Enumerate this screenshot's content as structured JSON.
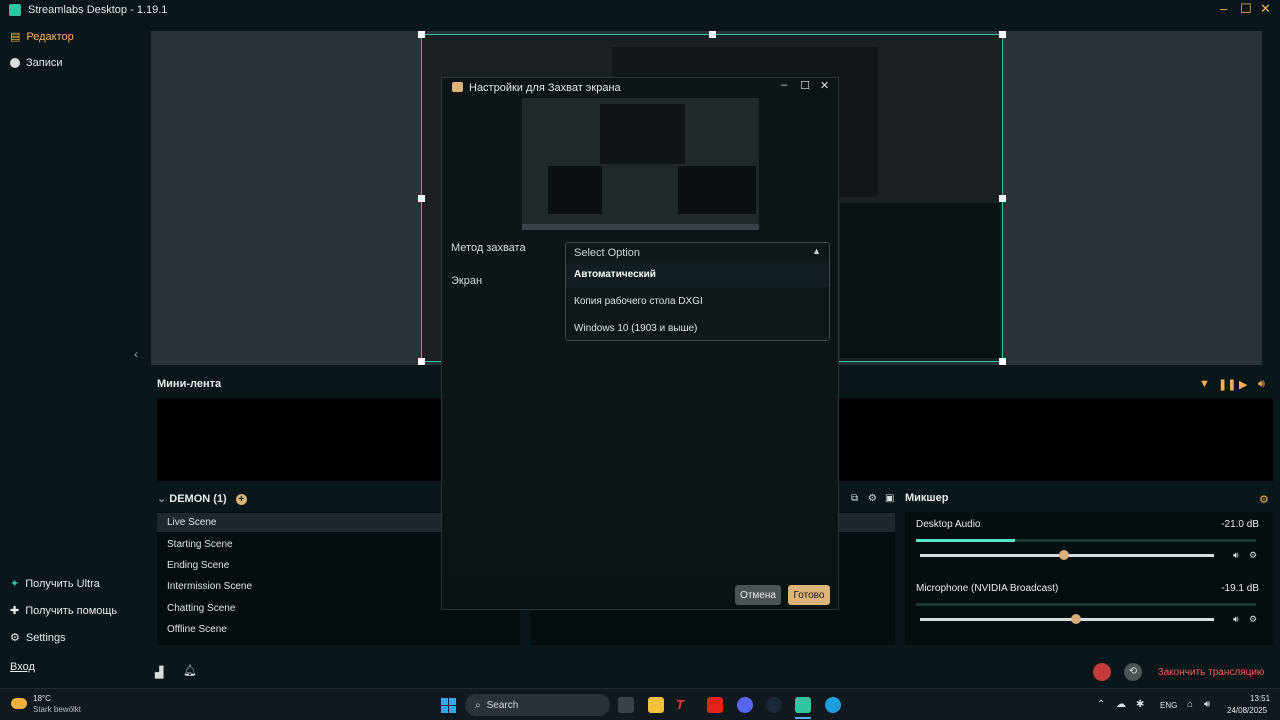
{
  "window": {
    "title": "Streamlabs Desktop - 1.19.1"
  },
  "nav": {
    "items": [
      {
        "label": "Редактор",
        "icon": "editor-icon"
      },
      {
        "label": "Записи",
        "icon": "recordings-icon"
      }
    ],
    "bottom_items": [
      {
        "label": "Получить Ultra",
        "icon": "ultra-icon"
      },
      {
        "label": "Получить помощь",
        "icon": "help-icon"
      },
      {
        "label": "Settings",
        "icon": "gear-icon"
      }
    ],
    "login_label": "Вход"
  },
  "minifeed": {
    "title": "Мини-лента"
  },
  "scenes": {
    "title": "DEMON (1)",
    "items": [
      "Live Scene",
      "Starting Scene",
      "Ending Scene",
      "Intermission Scene",
      "Chatting Scene",
      "Offline Scene"
    ],
    "active": "Live Scene"
  },
  "mixer": {
    "title": "Микшер",
    "channels": [
      {
        "name": "Desktop Audio",
        "db": "-21.0 dB",
        "level": 0.29,
        "volume": 0.49
      },
      {
        "name": "Microphone (NVIDIA Broadcast)",
        "db": "-19.1 dB",
        "level": 0.0,
        "volume": 0.53
      }
    ]
  },
  "bottombar": {
    "end_stream_label": "Закончить трансляцию"
  },
  "dialog": {
    "title": "Настройки для Захват экрана",
    "fields": [
      {
        "label": "Метод захвата"
      },
      {
        "label": "Экран"
      }
    ],
    "select": {
      "placeholder": "Select Option",
      "options": [
        "Автоматический",
        "Копия рабочего стола DXGI",
        "Windows 10 (1903 и выше)"
      ],
      "highlighted": "Автоматический"
    },
    "cancel_label": "Отмена",
    "done_label": "Готово"
  },
  "taskbar": {
    "weather_temp": "18°C",
    "weather_desc": "Stark bewölkt",
    "search_placeholder": "Search",
    "lang": "ENG",
    "time": "13:51",
    "date": "24/08/2025"
  },
  "colors": {
    "accent": "#31c3a2",
    "brand_orange": "#ffb057",
    "done_button": "#ddb37a",
    "end_stream": "#ff5b5b"
  }
}
